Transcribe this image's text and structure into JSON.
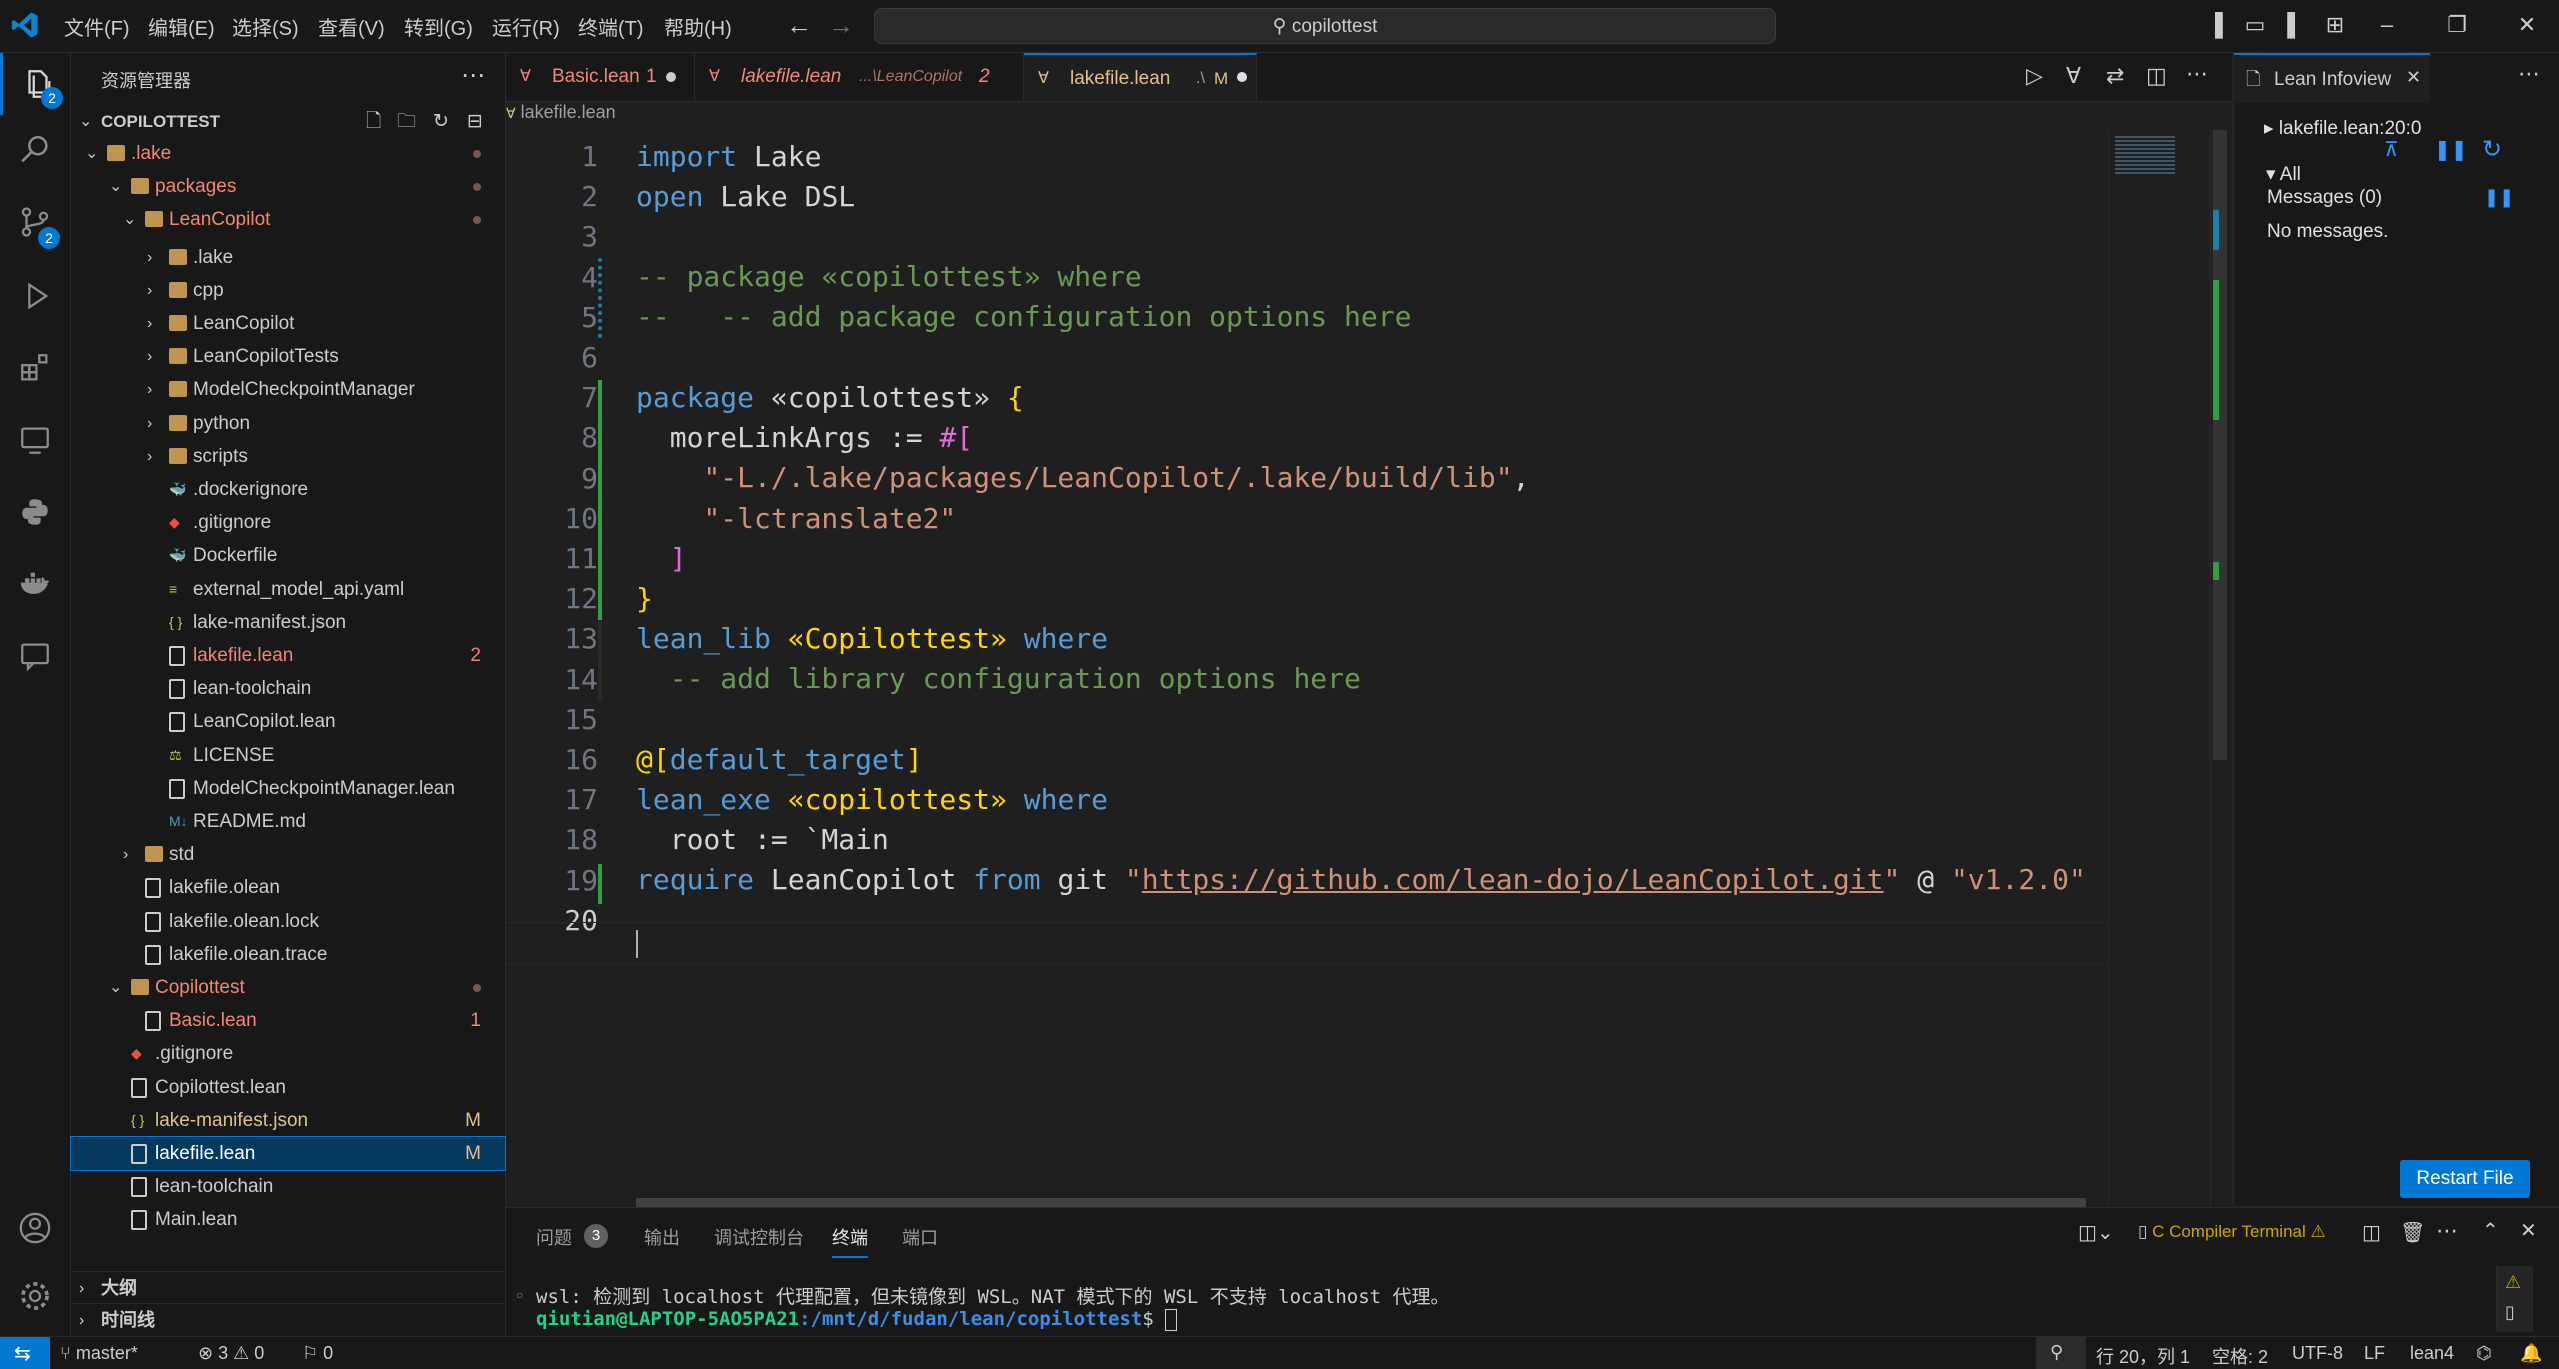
{
  "titlebar": {
    "menu": [
      "文件(F)",
      "编辑(E)",
      "选择(S)",
      "查看(V)",
      "转到(G)",
      "运行(R)",
      "终端(T)",
      "帮助(H)"
    ],
    "search_text": "copilottest"
  },
  "activity": {
    "explorer_badge": "2",
    "scm_badge": "2"
  },
  "sidebar": {
    "title": "资源管理器",
    "root": "COPILOTTEST",
    "rows": [
      {
        "label": ".lake",
        "kind": "folder-open",
        "depth": 0,
        "color": "#f48771",
        "dot": true
      },
      {
        "label": "packages",
        "kind": "folder-open",
        "depth": 1,
        "color": "#f48771",
        "dot": true
      },
      {
        "label": "LeanCopilot",
        "kind": "folder-open",
        "depth": 2,
        "color": "#f48771",
        "dot": true
      },
      {
        "label": ".lake",
        "kind": "folder",
        "depth": 3
      },
      {
        "label": "cpp",
        "kind": "folder",
        "depth": 3
      },
      {
        "label": "LeanCopilot",
        "kind": "folder",
        "depth": 3
      },
      {
        "label": "LeanCopilotTests",
        "kind": "folder",
        "depth": 3
      },
      {
        "label": "ModelCheckpointManager",
        "kind": "folder",
        "depth": 3
      },
      {
        "label": "python",
        "kind": "folder",
        "depth": 3
      },
      {
        "label": "scripts",
        "kind": "folder",
        "depth": 3
      },
      {
        "label": ".dockerignore",
        "kind": "docker",
        "depth": 3
      },
      {
        "label": ".gitignore",
        "kind": "git",
        "depth": 3
      },
      {
        "label": "Dockerfile",
        "kind": "docker",
        "depth": 3
      },
      {
        "label": "external_model_api.yaml",
        "kind": "yaml",
        "depth": 3
      },
      {
        "label": "lake-manifest.json",
        "kind": "json",
        "depth": 3
      },
      {
        "label": "lakefile.lean",
        "kind": "file",
        "depth": 3,
        "color": "#f48771",
        "badge": "2"
      },
      {
        "label": "lean-toolchain",
        "kind": "file",
        "depth": 3
      },
      {
        "label": "LeanCopilot.lean",
        "kind": "file",
        "depth": 3
      },
      {
        "label": "LICENSE",
        "kind": "license",
        "depth": 3
      },
      {
        "label": "ModelCheckpointManager.lean",
        "kind": "file",
        "depth": 3
      },
      {
        "label": "README.md",
        "kind": "md",
        "depth": 3
      },
      {
        "label": "std",
        "kind": "folder",
        "depth": 2
      },
      {
        "label": "lakefile.olean",
        "kind": "file",
        "depth": 2
      },
      {
        "label": "lakefile.olean.lock",
        "kind": "file",
        "depth": 2
      },
      {
        "label": "lakefile.olean.trace",
        "kind": "file",
        "depth": 2
      },
      {
        "label": "Copilottest",
        "kind": "folder-open",
        "depth": 1,
        "color": "#f48771",
        "dot": true
      },
      {
        "label": "Basic.lean",
        "kind": "file",
        "depth": 2,
        "color": "#f48771",
        "badge": "1"
      },
      {
        "label": ".gitignore",
        "kind": "git",
        "depth": 1
      },
      {
        "label": "Copilottest.lean",
        "kind": "file",
        "depth": 1
      },
      {
        "label": "lake-manifest.json",
        "kind": "json",
        "depth": 1,
        "color": "#e2c08d",
        "badge": "M"
      },
      {
        "label": "lakefile.lean",
        "kind": "file",
        "depth": 1,
        "color": "#ffffff",
        "badge": "M",
        "selected": true
      },
      {
        "label": "lean-toolchain",
        "kind": "file",
        "depth": 1
      },
      {
        "label": "Main.lean",
        "kind": "file",
        "depth": 1
      }
    ],
    "outline": "大纲",
    "timeline": "时间线"
  },
  "tabs": [
    {
      "name": "Basic.lean",
      "suffix": "1",
      "desc": ""
    },
    {
      "name": "lakefile.lean",
      "suffix": "2",
      "desc": "...\\LeanCopilot"
    },
    {
      "name": "lakefile.lean",
      "suffix": "M",
      "desc": ".\\"
    }
  ],
  "breadcrumb": "lakefile.lean",
  "code_lines": [
    "1",
    "2",
    "3",
    "4",
    "5",
    "6",
    "7",
    "8",
    "9",
    "10",
    "11",
    "12",
    "13",
    "14",
    "15",
    "16",
    "17",
    "18",
    "19",
    "20"
  ],
  "code": {
    "l1a": "import",
    "l1b": " Lake",
    "l2a": "open",
    "l2b": " Lake DSL",
    "l4": "-- package «copilottest» where",
    "l5": "--   -- add package configuration options here",
    "l7a": "package",
    "l7b": " «copilottest» ",
    "l7c": "{",
    "l8a": "  moreLinkArgs := ",
    "l8b": "#[",
    "l9a": "    \"-L./.lake/packages/LeanCopilot/.lake/build/lib\"",
    "l9b": ",",
    "l10": "    \"-lctranslate2\"",
    "l11": "  ]",
    "l12": "}",
    "l13a": "lean_lib",
    "l13b": " «Copilottest» ",
    "l13c": "where",
    "l14": "  -- add library configuration options here",
    "l16a": "@[",
    "l16b": "default_target",
    "l16c": "]",
    "l17a": "lean_exe",
    "l17b": " «copilottest» ",
    "l17c": "where",
    "l18": "  root := `Main",
    "l19a": "require",
    "l19b": " LeanCopilot ",
    "l19c": "from",
    "l19d": " git ",
    "l19e": "\"",
    "l19f": "https://github.com/lean-dojo/LeanCopilot.git",
    "l19g": "\"",
    "l19h": " @ ",
    "l19i": "\"v1.2.0\""
  },
  "infoview": {
    "tab": "Lean Infoview",
    "position": "lakefile.lean:20:0",
    "all": "All",
    "messages": "Messages (0)",
    "none": "No messages.",
    "restart": "Restart File"
  },
  "panel": {
    "tabs": [
      "问题",
      "输出",
      "调试控制台",
      "终端",
      "端口"
    ],
    "problems_count": "3",
    "terminal_name": "C Compiler Terminal",
    "line1": "wsl: 检测到 localhost 代理配置，但未镜像到 WSL。NAT 模式下的 WSL 不支持 localhost 代理。",
    "prompt_user": "qiutian@LAPTOP-5AO5PA21",
    "prompt_path": ":/mnt/d/fudan/lean/copilottest",
    "prompt_end": "$ "
  },
  "status": {
    "branch": "master*",
    "errors": "3",
    "warnings": "0",
    "info": "0",
    "position": "行 20，列 1",
    "spaces": "空格: 2",
    "encoding": "UTF-8",
    "eol": "LF",
    "language": "lean4"
  }
}
